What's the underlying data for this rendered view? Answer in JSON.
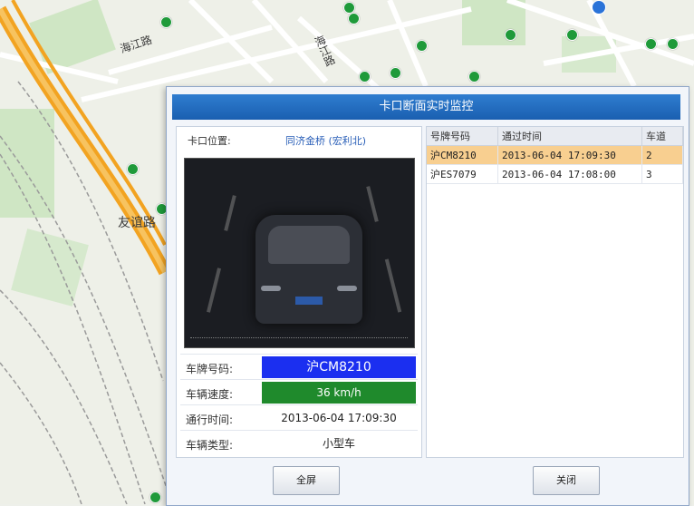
{
  "map": {
    "labels": [
      "海江路",
      "海江路",
      "友谊路"
    ]
  },
  "dialog": {
    "title": "卡口断面实时监控",
    "location_label": "卡口位置:",
    "location_value": "同济金桥 (宏利北)",
    "plate_label": "车牌号码:",
    "plate_value": "沪CM8210",
    "speed_label": "车辆速度:",
    "speed_value": "36 km/h",
    "time_label": "通行时间:",
    "time_value": "2013-06-04 17:09:30",
    "type_label": "车辆类型:",
    "type_value": "小型车",
    "table": {
      "headers": [
        "号牌号码",
        "通过时间",
        "车道"
      ],
      "rows": [
        [
          "沪CM8210",
          "2013-06-04 17:09:30",
          "2"
        ],
        [
          "沪ES7079",
          "2013-06-04 17:08:00",
          "3"
        ]
      ]
    },
    "fullscreen_label": "全屏",
    "close_label": "关闭",
    "colors": {
      "plate_bg": "#1b2ff0",
      "speed_bg": "#1f8a2c",
      "selected_row": "#f8cf90",
      "title_bar": "#1f66b8"
    }
  }
}
